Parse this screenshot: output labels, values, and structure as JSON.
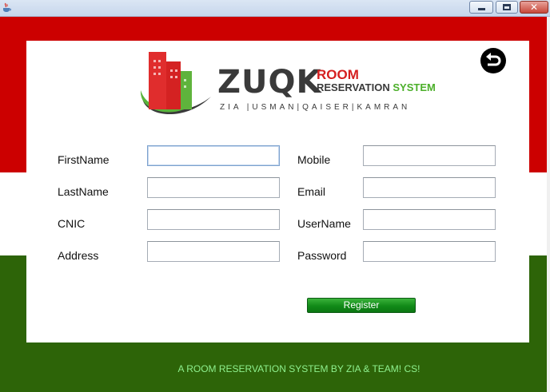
{
  "window": {
    "close_glyph": "✕"
  },
  "logo": {
    "word": "ZUQK",
    "room": "ROOM",
    "reservation": "RESERVATION",
    "system": "SYSTEM",
    "team": "ZIA |USMAN|QAISER|KAMRAN"
  },
  "form": {
    "first_name_label": "FirstName",
    "last_name_label": "LastName",
    "cnic_label": "CNIC",
    "address_label": "Address",
    "mobile_label": "Mobile",
    "email_label": "Email",
    "username_label": "UserName",
    "password_label": "Password",
    "first_name_value": "",
    "last_name_value": "",
    "cnic_value": "",
    "address_value": "",
    "mobile_value": "",
    "email_value": "",
    "username_value": "",
    "password_value": ""
  },
  "register_button": "Register",
  "footer_text": "A ROOM RESERVATION SYSTEM BY ZIA & TEAM! CS!",
  "icons": {
    "app": "java-app-icon",
    "back": "back-arrow-icon"
  },
  "colors": {
    "top_band": "#cc0000",
    "bottom_band": "#2d6408",
    "register_button": "#118a18",
    "footer_text": "#8ef08e"
  }
}
